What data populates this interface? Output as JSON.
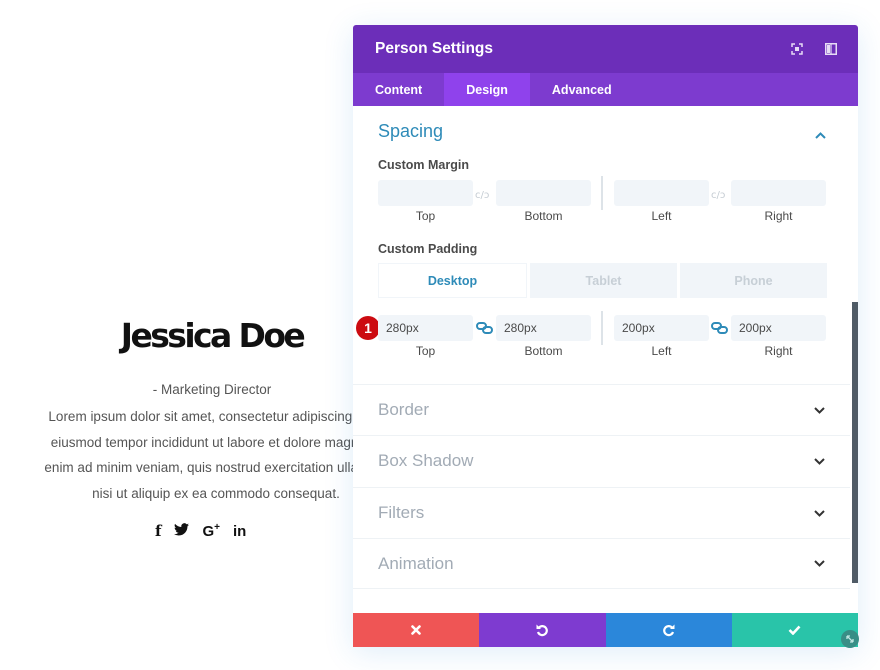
{
  "person": {
    "name": "Jessica Doe",
    "role": "- Marketing Director",
    "bio_lines": [
      "Lorem ipsum dolor sit amet, consectetur adipiscing elit, s",
      "eiusmod tempor incididunt ut labore et dolore magna ali",
      "enim ad minim veniam, quis nostrud exercitation ullamco",
      "nisi ut aliquip ex ea commodo consequat."
    ],
    "social": [
      "f",
      "y",
      "G+",
      "in"
    ]
  },
  "modal": {
    "title": "Person Settings",
    "tabs": [
      "Content",
      "Design",
      "Advanced"
    ],
    "active_tab": "Design",
    "section": "Spacing",
    "custom_margin": {
      "label": "Custom Margin",
      "fields": [
        {
          "caption": "Top",
          "value": ""
        },
        {
          "caption": "Bottom",
          "value": ""
        },
        {
          "caption": "Left",
          "value": ""
        },
        {
          "caption": "Right",
          "value": ""
        }
      ]
    },
    "custom_padding": {
      "label": "Custom Padding",
      "devices": [
        "Desktop",
        "Tablet",
        "Phone"
      ],
      "active_device": "Desktop",
      "fields": [
        {
          "caption": "Top",
          "value": "280px"
        },
        {
          "caption": "Bottom",
          "value": "280px"
        },
        {
          "caption": "Left",
          "value": "200px"
        },
        {
          "caption": "Right",
          "value": "200px"
        }
      ]
    },
    "step_badge": "1",
    "accordions": [
      "Border",
      "Box Shadow",
      "Filters",
      "Animation"
    ],
    "footer_colors": {
      "cancel": "#ef5555",
      "undo": "#7e3bd0",
      "redo": "#2b87da",
      "save": "#29c4a9"
    },
    "accent": "#2e8bb8"
  }
}
